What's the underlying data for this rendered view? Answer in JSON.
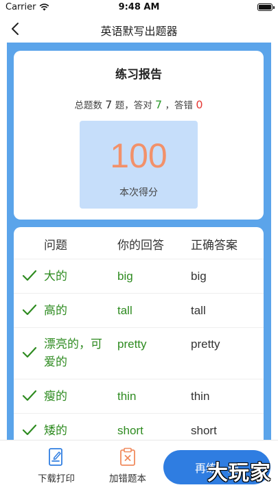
{
  "status_bar": {
    "carrier": "Carrier",
    "time": "9:48 AM"
  },
  "nav": {
    "title": "英语默写出题器"
  },
  "report": {
    "title": "练习报告",
    "summary_prefix": "总题数",
    "total": "7",
    "summary_mid1": "题，答对",
    "correct": "7",
    "summary_mid2": "，答错",
    "wrong": "0",
    "score": "100",
    "score_label": "本次得分"
  },
  "table": {
    "headers": {
      "question": "问题",
      "answer": "你的回答",
      "correct": "正确答案"
    },
    "rows": [
      {
        "question": "大的",
        "answer": "big",
        "correct": "big"
      },
      {
        "question": "高的",
        "answer": "tall",
        "correct": "tall"
      },
      {
        "question": "漂亮的，可爱的",
        "answer": "pretty",
        "correct": "pretty"
      },
      {
        "question": "瘦的",
        "answer": "thin",
        "correct": "thin"
      },
      {
        "question": "矮的",
        "answer": "short",
        "correct": "short"
      }
    ]
  },
  "bottom": {
    "download_label": "下载打印",
    "add_wrong_label": "加错题本",
    "practice_label": "再练一遍",
    "watermark": "大玩家"
  },
  "colors": {
    "accent": "#2f7de1",
    "frame": "#5ba4ea",
    "correct": "#2e8b20",
    "wrong": "#e53935",
    "score": "#f2916a"
  }
}
